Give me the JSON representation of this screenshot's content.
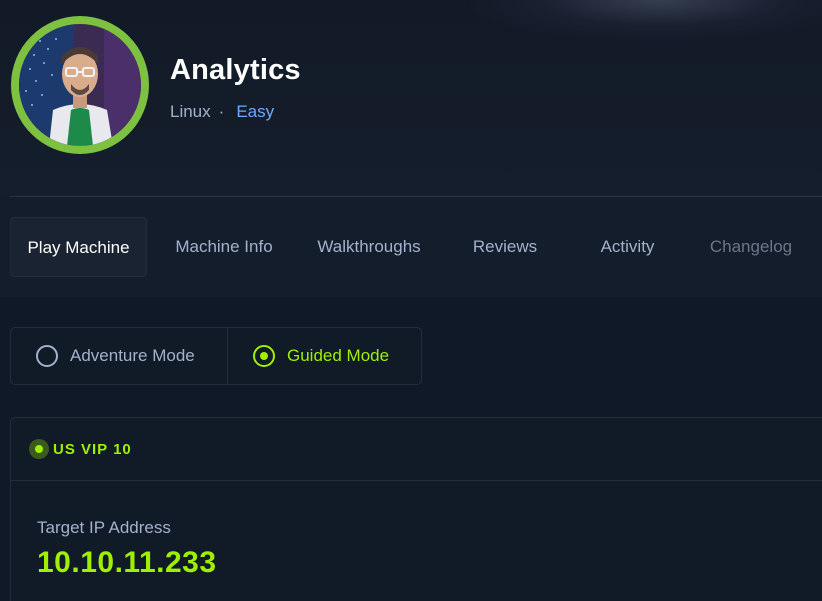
{
  "machine": {
    "name": "Analytics",
    "os": "Linux",
    "separator": "·",
    "difficulty": "Easy",
    "avatar_icon": "scientist-avatar-icon"
  },
  "tabs": [
    {
      "label": "Play Machine",
      "state": "active"
    },
    {
      "label": "Machine Info",
      "state": "normal"
    },
    {
      "label": "Walkthroughs",
      "state": "normal"
    },
    {
      "label": "Reviews",
      "state": "normal"
    },
    {
      "label": "Activity",
      "state": "normal"
    },
    {
      "label": "Changelog",
      "state": "disabled"
    }
  ],
  "modes": {
    "adventure_label": "Adventure Mode",
    "guided_label": "Guided Mode",
    "selected": "guided"
  },
  "connection": {
    "server": "US VIP 10",
    "status": "online",
    "ip_label": "Target IP Address",
    "ip": "10.10.11.233"
  },
  "colors": {
    "accent_green": "#9fef00",
    "difficulty_blue": "#6fa9ff",
    "muted_text": "#a4b1cd",
    "background": "#141d2b"
  }
}
